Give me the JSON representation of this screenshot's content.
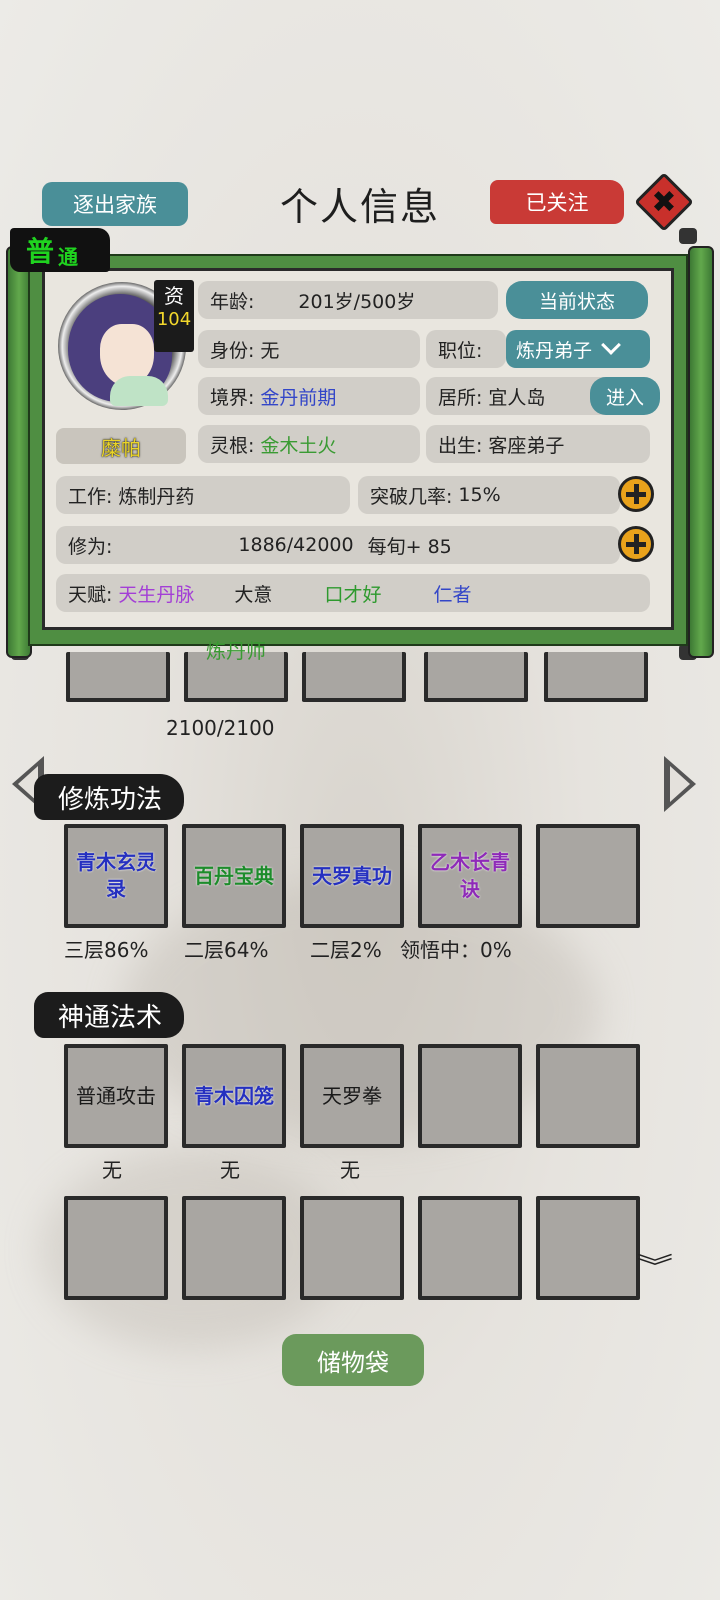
{
  "header": {
    "expel_label": "逐出家族",
    "title": "个人信息",
    "follow_label": "已关注",
    "close_glyph": "✖"
  },
  "character": {
    "grade_main": "普",
    "grade_sub": "通",
    "aptitude_label": "资",
    "aptitude_value": "104",
    "name": "糜帕",
    "age_label": "年龄:",
    "age_value": "201岁/500岁",
    "status_button": "当前状态",
    "identity_label": "身份:",
    "identity_value": "无",
    "position_label": "职位:",
    "position_value": "炼丹弟子",
    "realm_label": "境界:",
    "realm_value": "金丹前期",
    "residence_label": "居所:",
    "residence_value": "宜人岛",
    "enter_button": "进入",
    "root_label": "灵根:",
    "root_value": "金木土火",
    "origin_label": "出生:",
    "origin_value": "客座弟子",
    "work_label": "工作:",
    "work_value": "炼制丹药",
    "breakthrough_label": "突破几率:",
    "breakthrough_value": "15%",
    "cultivation_label": "修为:",
    "cultivation_value": "1886/42000",
    "cultivation_rate": "每旬+ 85",
    "talent_label": "天赋:",
    "talents": [
      "天生丹脉",
      "大意",
      "口才好",
      "仁者"
    ]
  },
  "profession_row": {
    "slots": [
      "",
      "炼丹师",
      "",
      "",
      ""
    ],
    "caption": "2100/2100"
  },
  "techniques": {
    "title": "修炼功法",
    "slots": [
      "青木玄灵录",
      "百丹宝典",
      "天罗真功",
      "乙木长青诀",
      ""
    ],
    "slot_lines": [
      [
        "青木玄灵",
        "录"
      ],
      [
        "百丹宝典"
      ],
      [
        "天罗真功"
      ],
      [
        "乙木长青",
        "诀"
      ],
      [
        ""
      ]
    ],
    "progress": [
      "三层86%",
      "二层64%",
      "二层2%",
      "领悟中：0%"
    ]
  },
  "spells": {
    "title": "神通法术",
    "slots": [
      "普通攻击",
      "青木囚笼",
      "天罗拳",
      "",
      "",
      "",
      "",
      "",
      "",
      ""
    ],
    "captions": [
      "无",
      "无",
      "无"
    ]
  },
  "footer": {
    "bag_label": "储物袋"
  },
  "colors": {
    "teal": "#4a8f98",
    "red": "#c93a36",
    "green_frame": "#4f8e42",
    "gold": "#e9a21b"
  }
}
